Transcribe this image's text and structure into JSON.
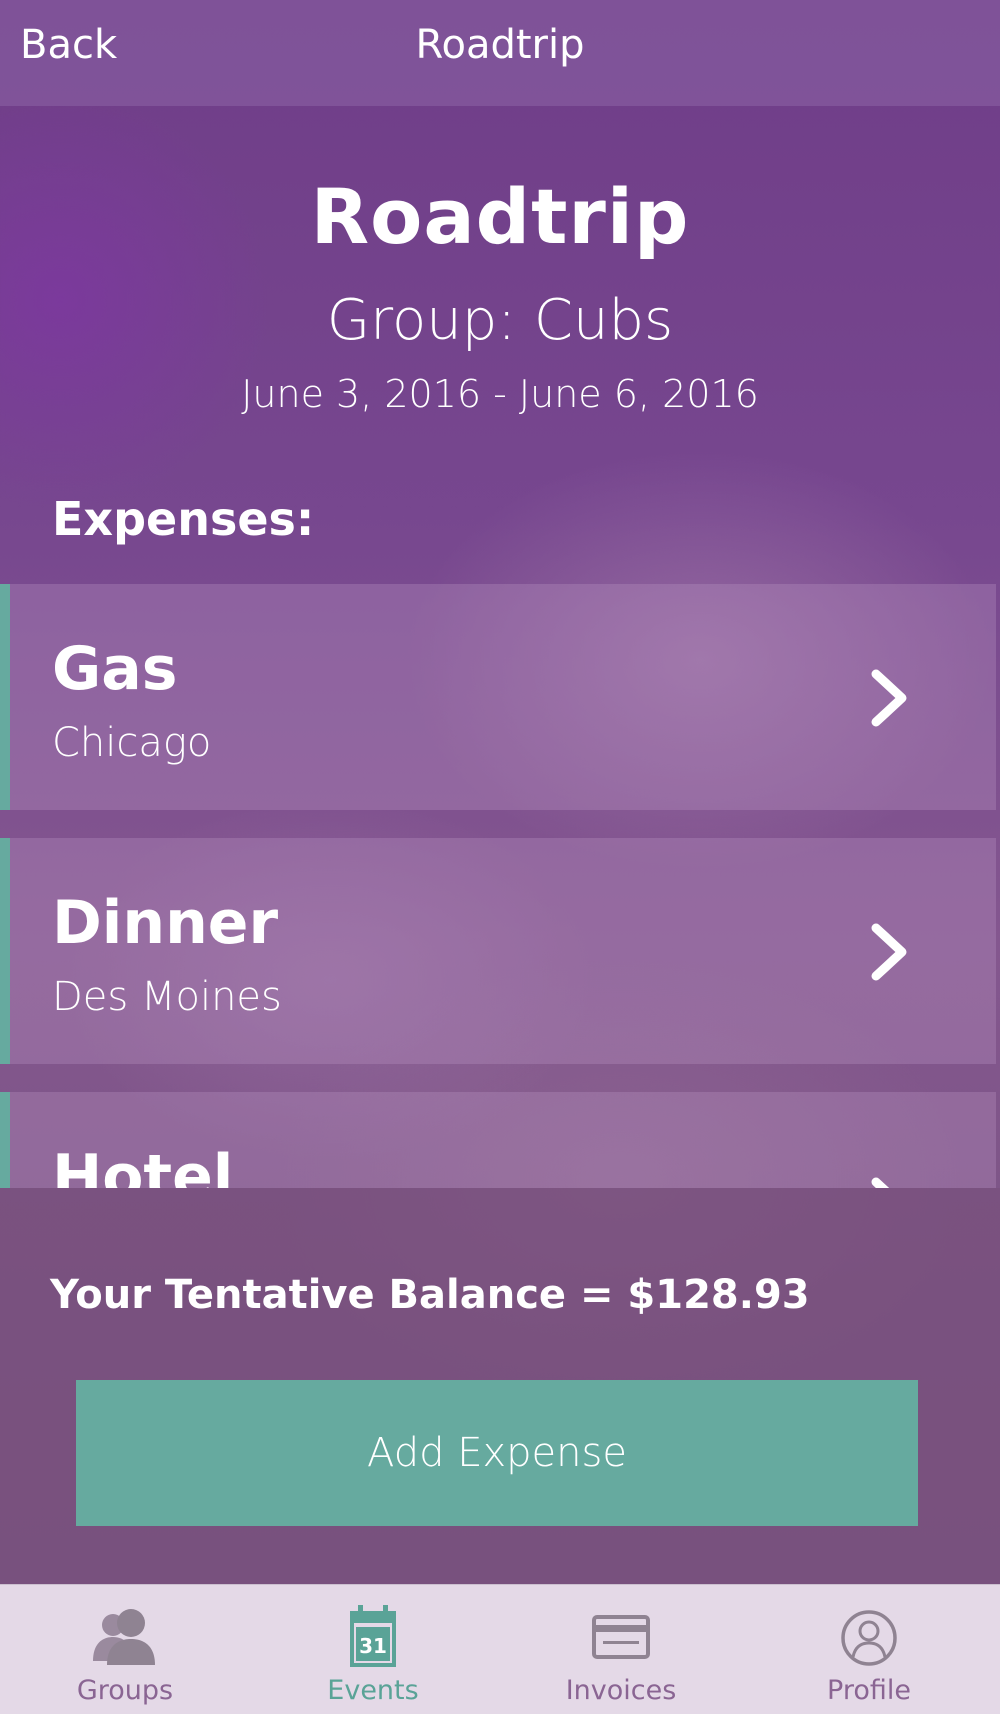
{
  "nav": {
    "back_label": "Back",
    "title": "Roadtrip"
  },
  "event": {
    "title": "Roadtrip",
    "group_line": "Group: Cubs",
    "date_range": "June 3, 2016 - June 6, 2016"
  },
  "expenses": {
    "section_label": "Expenses:",
    "items": [
      {
        "name": "Gas",
        "location": "Chicago"
      },
      {
        "name": "Dinner",
        "location": "Des Moines"
      },
      {
        "name": "Hotel",
        "location": ""
      }
    ]
  },
  "summary": {
    "balance_text": "Your Tentative Balance = $128.93",
    "add_expense_label": "Add Expense"
  },
  "tabbar": {
    "active": "Events",
    "tabs": [
      {
        "label": "Groups",
        "icon": "groups-icon"
      },
      {
        "label": "Events",
        "icon": "calendar-icon",
        "icon_text": "31"
      },
      {
        "label": "Invoices",
        "icon": "credit-card-icon"
      },
      {
        "label": "Profile",
        "icon": "profile-icon"
      }
    ]
  },
  "colors": {
    "accent": "#66aa9f",
    "background": "#77478f",
    "tabbar_background": "#e4d9e7",
    "tab_inactive": "#8a6593"
  }
}
